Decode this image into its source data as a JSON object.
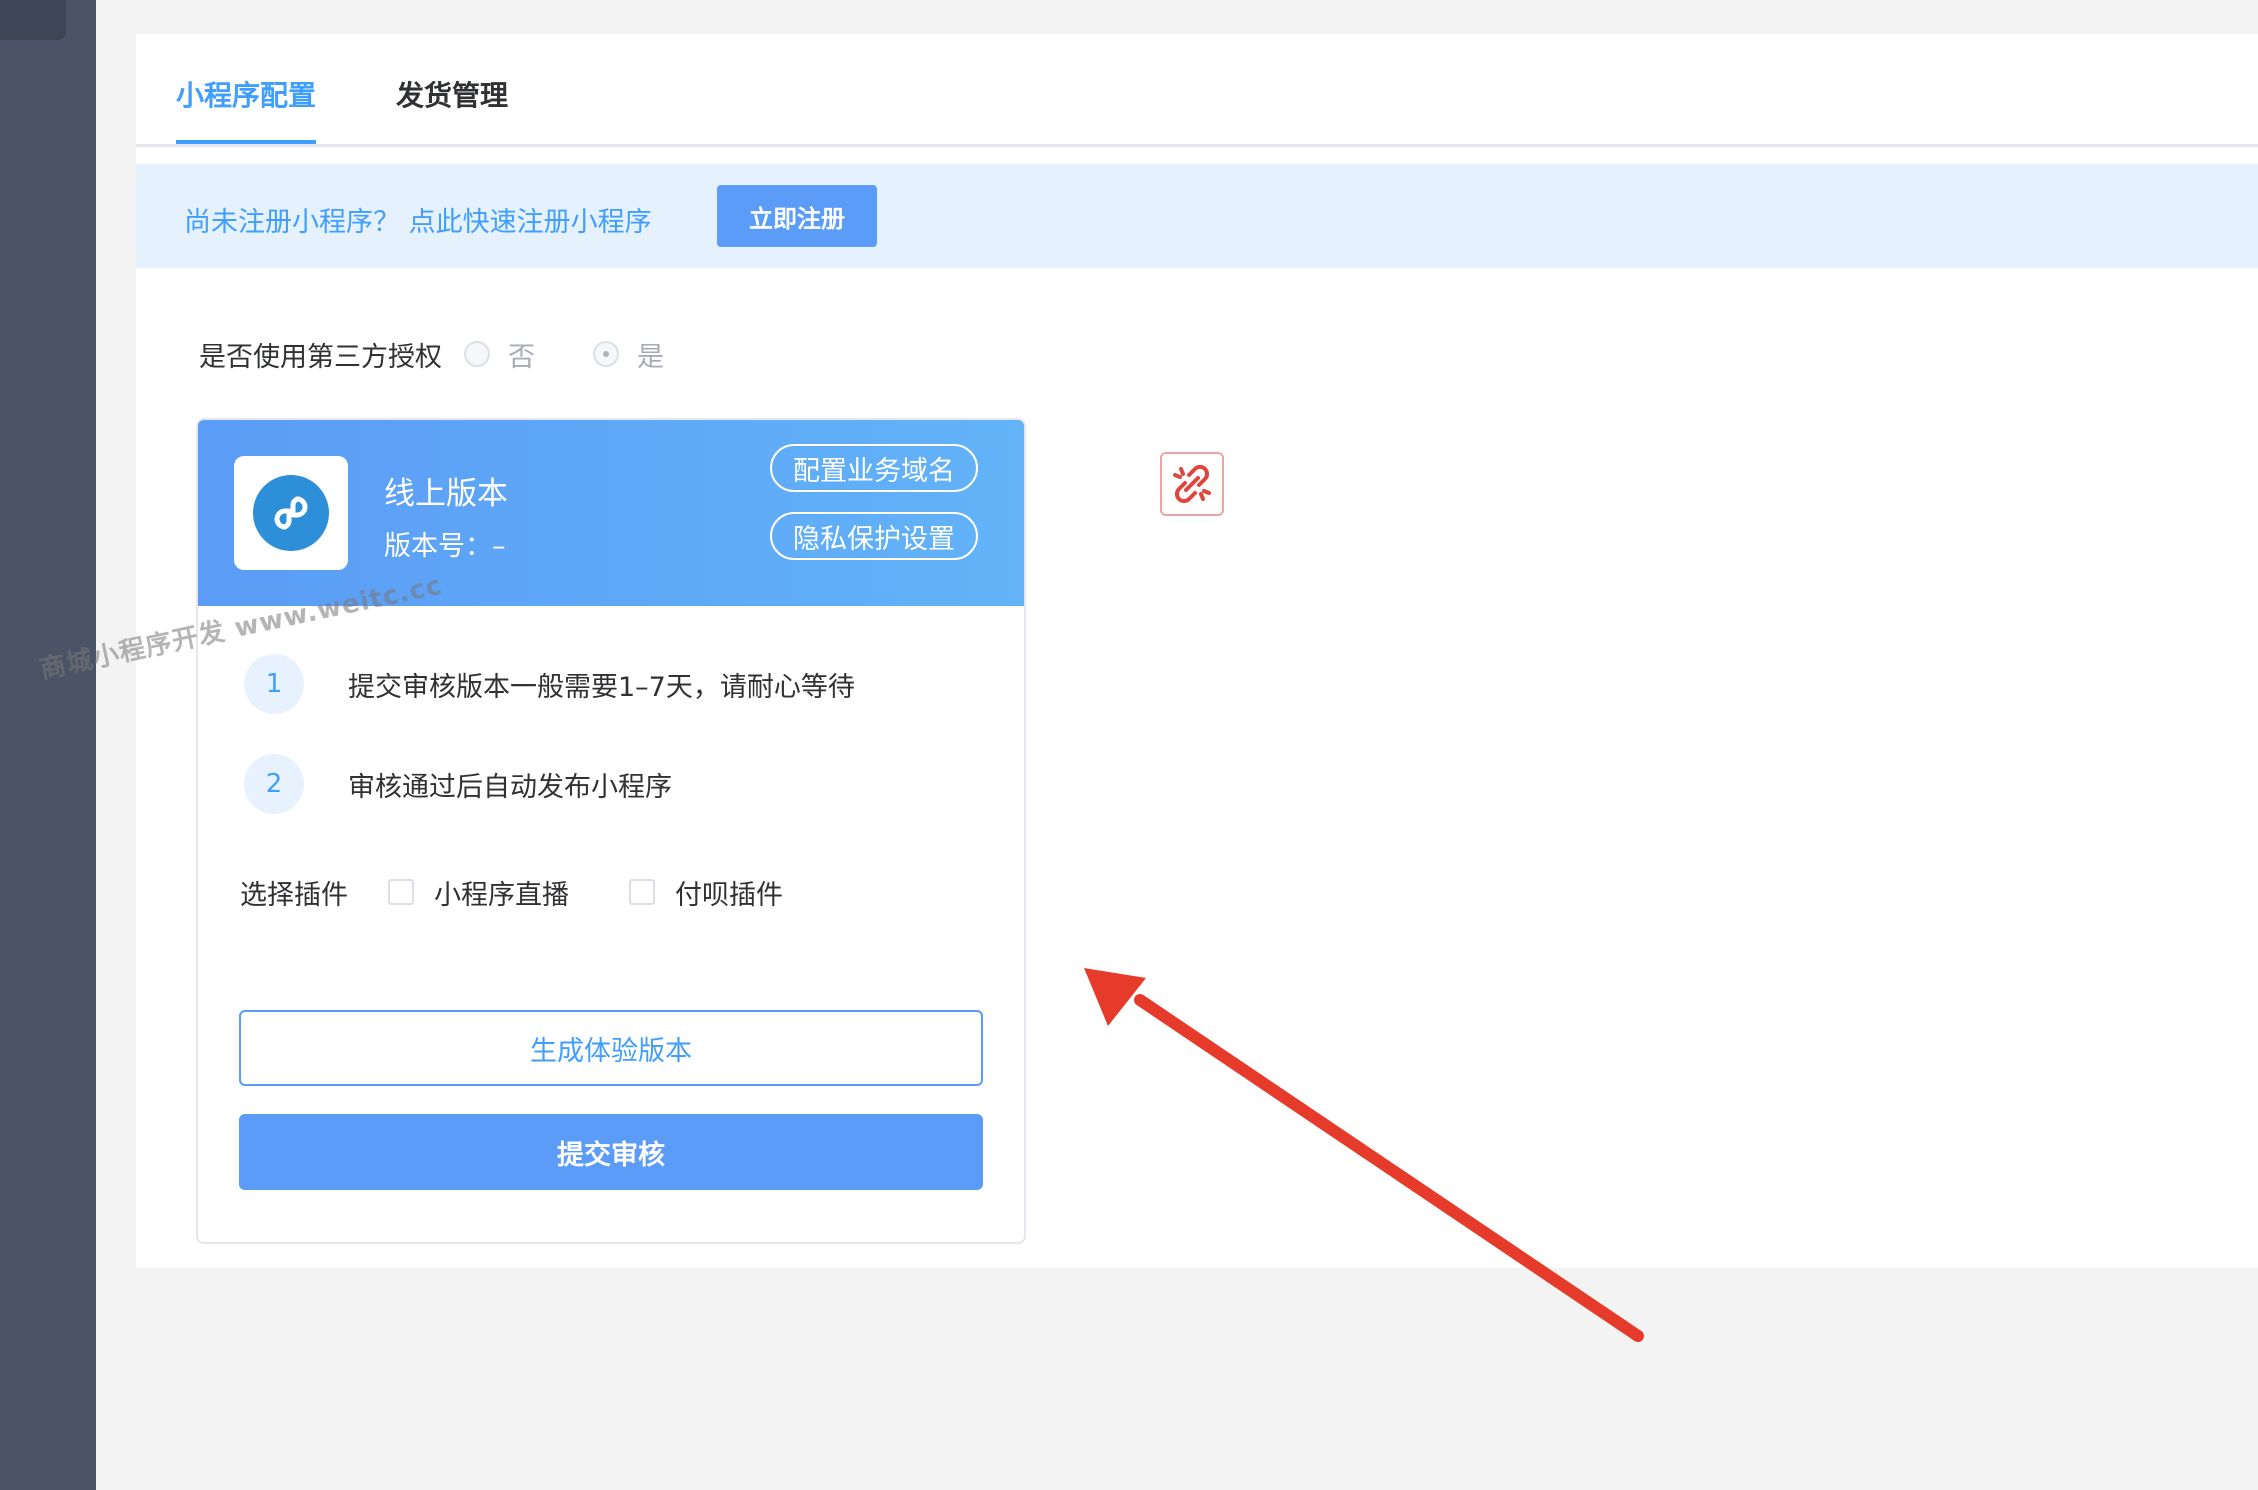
{
  "tabs": [
    {
      "label": "小程序配置",
      "active": true
    },
    {
      "label": "发货管理",
      "active": false
    }
  ],
  "notice": {
    "text": "尚未注册小程序？ 点此快速注册小程序",
    "button": "立即注册"
  },
  "auth": {
    "label": "是否使用第三方授权",
    "options": [
      {
        "label": "否",
        "checked": false
      },
      {
        "label": "是",
        "checked": true
      }
    ]
  },
  "card": {
    "title": "线上版本",
    "version": "版本号：–",
    "buttons": {
      "domain": "配置业务域名",
      "privacy": "隐私保护设置"
    },
    "steps": [
      {
        "num": "1",
        "text": "提交审核版本一般需要1–7天，请耐心等待"
      },
      {
        "num": "2",
        "text": "审核通过后自动发布小程序"
      }
    ],
    "plugins": {
      "label": "选择插件",
      "options": [
        {
          "label": "小程序直播",
          "checked": false
        },
        {
          "label": "付呗插件",
          "checked": false
        }
      ]
    },
    "preview_button": "生成体验版本",
    "submit_button": "提交审核"
  },
  "watermark": "商城小程序开发 www.weitc.cc",
  "icons": {
    "app_logo": "mini-program-icon",
    "unlink": "unlink-icon"
  },
  "colors": {
    "accent": "#409eff",
    "primary_button": "#5a9cf8",
    "arrow": "#e63a2a",
    "sidebar": "#4a5466"
  }
}
